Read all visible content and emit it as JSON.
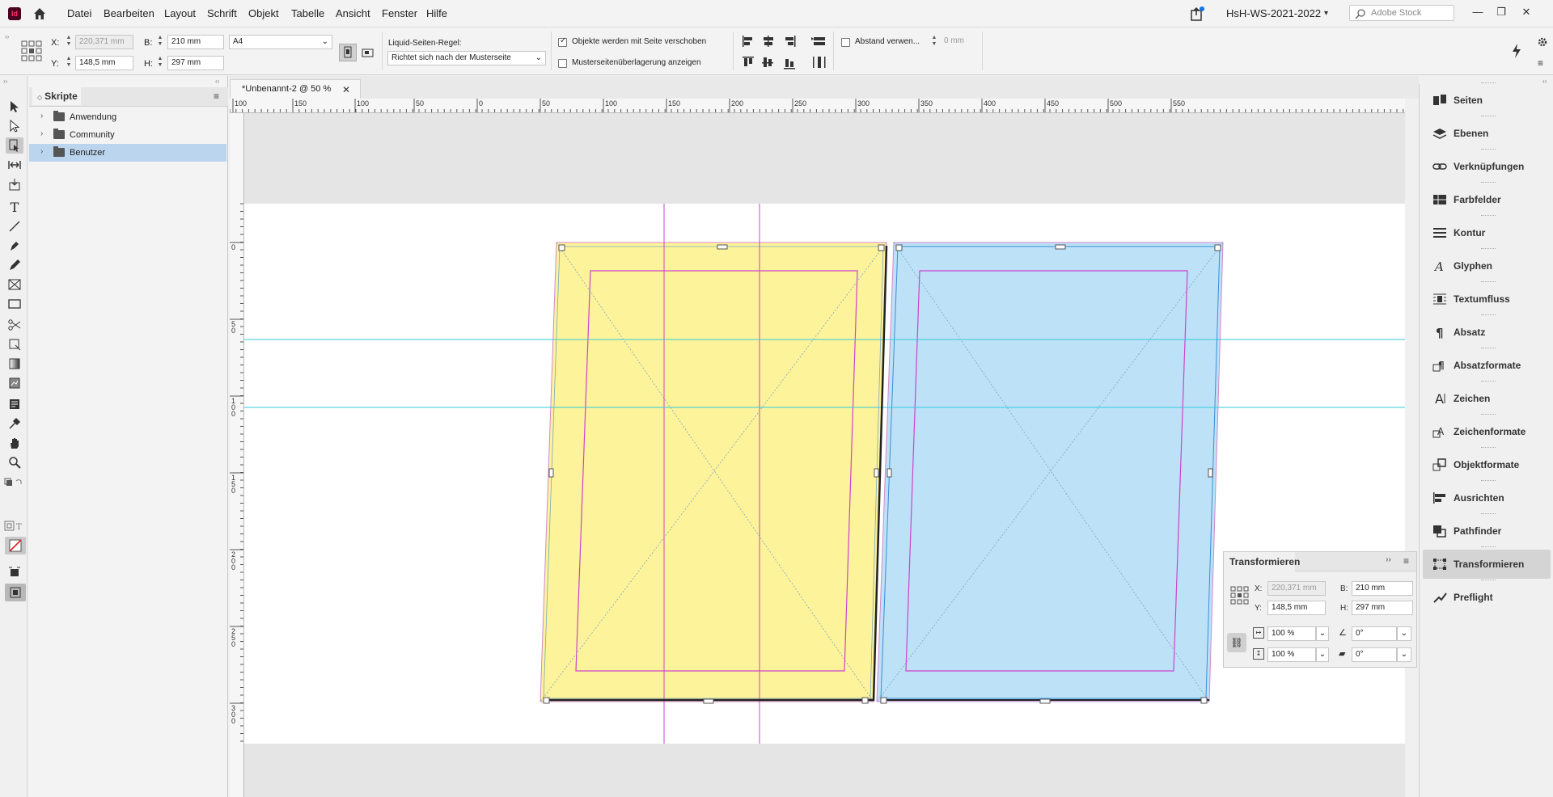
{
  "app": {
    "icon_text": "Id"
  },
  "menu": [
    "Datei",
    "Bearbeiten",
    "Layout",
    "Schrift",
    "Objekt",
    "Tabelle",
    "Ansicht",
    "Fenster",
    "Hilfe"
  ],
  "workspace": "HsH-WS-2021-2022",
  "stock_search": {
    "placeholder": "Adobe Stock"
  },
  "control": {
    "x_label": "X:",
    "x_value": "220,371 mm",
    "y_label": "Y:",
    "y_value": "148,5 mm",
    "b_label": "B:",
    "b_value": "210 mm",
    "h_label": "H:",
    "h_value": "297 mm",
    "page_size": "A4",
    "liquid_label": "Liquid-Seiten-Regel:",
    "liquid_value": "Richtet sich nach der Musterseite",
    "chk_objects": "Objekte werden mit Seite verschoben",
    "chk_objects_checked": true,
    "chk_master": "Musterseitenüberlagerung anzeigen",
    "chk_master_checked": false,
    "spacing_label": "Abstand verwen...",
    "spacing_value": "0 mm"
  },
  "scripts_panel": {
    "title": "Skripte",
    "items": [
      {
        "label": "Anwendung",
        "selected": false
      },
      {
        "label": "Community",
        "selected": false
      },
      {
        "label": "Benutzer",
        "selected": true
      }
    ]
  },
  "document": {
    "tab_title": "*Unbenannt-2 @ 50 %"
  },
  "ruler": {
    "h_labels": [
      "100",
      "150",
      "100",
      "50",
      "0",
      "50",
      "100",
      "150",
      "200",
      "250",
      "300",
      "350",
      "400",
      "450",
      "500",
      "550"
    ],
    "v_labels": [
      "0",
      "50",
      "100",
      "150",
      "200",
      "250",
      "300"
    ]
  },
  "colors": {
    "yellow_page": "#fdf39a",
    "blue_page": "#bde1f7",
    "guide_cyan": "#33ccdd",
    "guide_magenta": "#cc44cc",
    "selection": "#222222"
  },
  "dock": [
    {
      "label": "Seiten",
      "icon": "pages-icon"
    },
    {
      "label": "Ebenen",
      "icon": "layers-icon"
    },
    {
      "label": "Verknüpfungen",
      "icon": "links-icon"
    },
    {
      "label": "Farbfelder",
      "icon": "swatches-icon"
    },
    {
      "label": "Kontur",
      "icon": "stroke-icon"
    },
    {
      "label": "Glyphen",
      "icon": "glyphs-icon"
    },
    {
      "label": "Textumfluss",
      "icon": "text-wrap-icon"
    },
    {
      "label": "Absatz",
      "icon": "paragraph-icon"
    },
    {
      "label": "Absatzformate",
      "icon": "paragraph-styles-icon"
    },
    {
      "label": "Zeichen",
      "icon": "character-icon"
    },
    {
      "label": "Zeichenformate",
      "icon": "character-styles-icon"
    },
    {
      "label": "Objektformate",
      "icon": "object-styles-icon"
    },
    {
      "label": "Ausrichten",
      "icon": "align-icon"
    },
    {
      "label": "Pathfinder",
      "icon": "pathfinder-icon"
    },
    {
      "label": "Transformieren",
      "icon": "transform-icon",
      "selected": true
    },
    {
      "label": "Preflight",
      "icon": "preflight-icon"
    }
  ],
  "transform_panel": {
    "title": "Transformieren",
    "x_label": "X:",
    "x_value": "220,371 mm",
    "y_label": "Y:",
    "y_value": "148,5 mm",
    "b_label": "B:",
    "b_value": "210 mm",
    "h_label": "H:",
    "h_value": "297 mm",
    "scale_x": "100 %",
    "scale_y": "100 %",
    "rotate": "0°",
    "shear": "0°"
  }
}
